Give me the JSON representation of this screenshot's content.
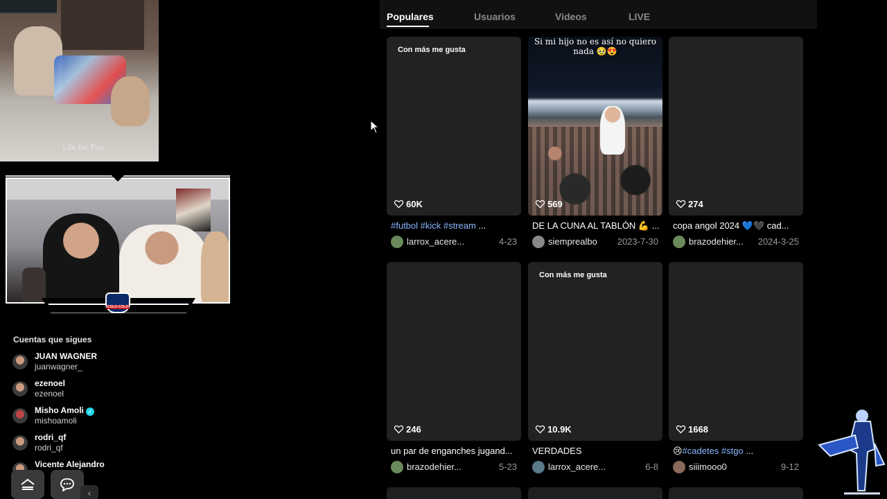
{
  "stream": {
    "top_cam_watermark": "Life for Fun",
    "badge_text": "COLO-COLO"
  },
  "following": {
    "title": "Cuentas que sigues",
    "accounts": [
      {
        "name": "JUAN WAGNER",
        "handle": "juanwagner_",
        "verified": false
      },
      {
        "name": "ezenoel",
        "handle": "ezenoel",
        "verified": false
      },
      {
        "name": "Misho Amoli",
        "handle": "mishoamoli",
        "verified": true
      },
      {
        "name": "rodri_qf",
        "handle": "rodri_qf",
        "verified": false
      },
      {
        "name": "Vicente Alejandro",
        "handle": "",
        "verified": false
      }
    ]
  },
  "tabs": [
    {
      "label": "Populares",
      "active": true
    },
    {
      "label": "Usuarios",
      "active": false
    },
    {
      "label": "Videos",
      "active": false
    },
    {
      "label": "LIVE",
      "active": false
    }
  ],
  "videos": [
    {
      "tag": "Con más me gusta",
      "likes": "60K",
      "desc_tags": "#futbol #kick #stream",
      "desc_text": " ...",
      "author": "larrox_acere...",
      "date": "4-23"
    },
    {
      "tag": "",
      "likes": "569",
      "desc_tags": "",
      "desc_text": "DE LA CUNA AL TABLÓN 💪 ...",
      "author": "siemprealbo",
      "date": "2023-7-30",
      "caption": "Si mi hijo no es así no quiero nada 🥹😍"
    },
    {
      "tag": "",
      "likes": "274",
      "desc_tags": "",
      "desc_text": "copa angol 2024 💙🖤 cad...",
      "author": "brazodehier...",
      "date": "2024-3-25"
    },
    {
      "tag": "",
      "likes": "246",
      "desc_tags": "",
      "desc_text": "un par de enganches jugand...",
      "author": "brazodehier...",
      "date": "5-23"
    },
    {
      "tag": "Con más me gusta",
      "likes": "10.9K",
      "desc_tags": "",
      "desc_text": "VERDADES",
      "author": "larrox_acere...",
      "date": "6-8"
    },
    {
      "tag": "",
      "likes": "1668",
      "desc_tags": "#cadetes #stgo",
      "desc_text": " ...",
      "desc_prefix": "😢",
      "author": "siiimooo0",
      "date": "9-12"
    }
  ],
  "icons": {
    "heart": "heart-icon",
    "home": "home-icon",
    "chat": "chat-icon",
    "collapse": "chevron-left-icon"
  },
  "colors": {
    "background": "#000000",
    "card": "#222224",
    "hashtag": "#8ab6ff",
    "verified": "#20d5ec"
  }
}
